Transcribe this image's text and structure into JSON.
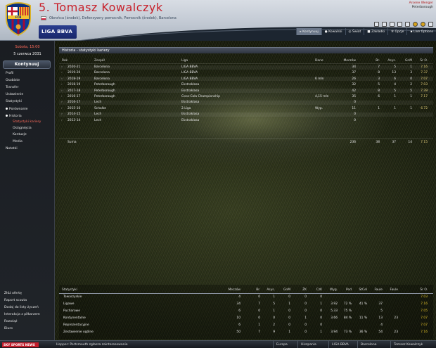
{
  "header": {
    "player_name": "5. Tomasz Kowalczyk",
    "positions": "Obrońca (środek), Defensywny pomocnik, Pomocnik (środek), Barcelona",
    "league_logo_text": "LIGA BBVA",
    "manager_name": "Arsene Wenger",
    "manager_club": "Peterborough",
    "flag_colors": [
      "#ffffff",
      "#d4213d"
    ]
  },
  "toolbar": {
    "items": [
      {
        "label": "Kontynuuj",
        "icon": "arrow-icon"
      },
      {
        "label": "Kowalski",
        "icon": "person-icon"
      },
      {
        "label": "Świat",
        "icon": "globe-icon"
      },
      {
        "label": "Zakładki",
        "icon": "bookmark-icon"
      },
      {
        "label": "Opcje",
        "icon": "gear-icon"
      },
      {
        "label": "Live Options",
        "icon": "live-icon"
      }
    ]
  },
  "sidebar": {
    "date": "Sobota, 15:00",
    "date2": "5 czerwca 2031",
    "continue_label": "Kontynuuj",
    "items": [
      {
        "label": "Profil",
        "sub": false,
        "active": false,
        "dot": false
      },
      {
        "label": "Osobiste",
        "sub": false,
        "active": false,
        "dot": false
      },
      {
        "label": "Transfer",
        "sub": false,
        "active": false,
        "dot": false
      },
      {
        "label": "Ustawienie",
        "sub": false,
        "active": false,
        "dot": false
      },
      {
        "label": "Statystyki",
        "sub": false,
        "active": false,
        "dot": false
      },
      {
        "label": "Porównanie",
        "sub": false,
        "active": false,
        "dot": true
      },
      {
        "label": "Historia",
        "sub": false,
        "active": false,
        "dot": true
      },
      {
        "label": "Statystyki kariery",
        "sub": true,
        "active": true,
        "dot": false
      },
      {
        "label": "Osiągnięcia",
        "sub": true,
        "active": false,
        "dot": false
      },
      {
        "label": "Kontuzje",
        "sub": true,
        "active": false,
        "dot": false
      },
      {
        "label": "Media",
        "sub": true,
        "active": false,
        "dot": false
      },
      {
        "label": "Notatki",
        "sub": false,
        "active": false,
        "dot": false
      }
    ],
    "bottom_items": [
      "Złóż ofertę",
      "Raport scouta",
      "Dodaj do listy życzeń",
      "Interakcja z piłkarzem",
      "Rozwiąż",
      "Biuro"
    ]
  },
  "career": {
    "title": "Historia - statystyki kariery",
    "columns": [
      "Rok",
      "Zespół",
      "Liga",
      "Dane",
      "Meczów",
      "Br.",
      "Asys.",
      "GnM",
      "Śr O."
    ],
    "rows": [
      [
        "2020-21",
        "Barcelona",
        "LIGA BBVA",
        "",
        "34",
        "7",
        "5",
        "1",
        "7.16"
      ],
      [
        "2019-20",
        "Barcelona",
        "LIGA BBVA",
        "",
        "37",
        "8",
        "13",
        "3",
        "7.37"
      ],
      [
        "2018-19",
        "Barcelona",
        "LIGA BBVA",
        "6 mln",
        "26",
        "3",
        "6",
        "0",
        "7.07"
      ],
      [
        "2018-19",
        "Peterborough",
        "Ekstraklasa",
        "",
        "32",
        "5",
        "4",
        "2",
        "7.03"
      ],
      [
        "2017-18",
        "Peterborough",
        "Ekstraklasa",
        "",
        "42",
        "8",
        "5",
        "5",
        "7.39"
      ],
      [
        "2016-17",
        "Peterborough",
        "Coca-Cola Championship",
        "4,15 mln",
        "35",
        "6",
        "1",
        "1",
        "7.17"
      ],
      [
        "2016-17",
        "Lech",
        "Ekstraklasa",
        "",
        "0",
        "",
        "",
        "",
        ""
      ],
      [
        "2015-16",
        "Schalke",
        "2.Liga",
        "Wyp.",
        "11",
        "1",
        "1",
        "1",
        "6.72"
      ],
      [
        "2014-15",
        "Lech",
        "Ekstraklasa",
        "",
        "0",
        "",
        "",
        "",
        ""
      ],
      [
        "2013-14",
        "Lech",
        "Ekstraklasa",
        "",
        "0",
        "",
        "",
        "",
        ""
      ]
    ],
    "total": [
      "Suma",
      "",
      "",
      "",
      "236",
      "38",
      "37",
      "14",
      "7.15"
    ]
  },
  "stats": {
    "columns": [
      "Statystyki",
      "Meczów",
      "Br.",
      "Asys.",
      "GnM",
      "ŻK",
      "CzK",
      "Wyg.",
      "Pod",
      "StCel",
      "Faule",
      "Faule",
      "Śr O."
    ],
    "rows": [
      [
        "Towarzyskie",
        "4",
        "0",
        "1",
        "0",
        "0",
        "0",
        "",
        "",
        "",
        "",
        "",
        "7.03"
      ],
      [
        "Ligowe",
        "34",
        "7",
        "5",
        "1",
        "0",
        "1",
        "3.92",
        "72 %",
        "41 %",
        "37",
        "",
        "7.16"
      ],
      [
        "Pucharowe",
        "6",
        "0",
        "1",
        "0",
        "0",
        "0",
        "5.33",
        "75 %",
        "",
        "5",
        "",
        "7.05"
      ],
      [
        "Kontynentalne",
        "10",
        "0",
        "0",
        "0",
        "1",
        "0",
        "3.66",
        "84 %",
        "11 %",
        "13",
        "23",
        "7.07"
      ],
      [
        "Reprezentacyjne",
        "6",
        "1",
        "2",
        "0",
        "0",
        "0",
        "",
        "",
        "",
        "4",
        "",
        "7.07"
      ],
      [
        "Zestawienie ogólne",
        "50",
        "7",
        "9",
        "1",
        "0",
        "1",
        "3.94",
        "73 %",
        "36 %",
        "54",
        "23",
        "7.16"
      ]
    ]
  },
  "footer": {
    "logo": "SKY SPORTS NEWS",
    "news": "Hopper: Portsmouth zgłasza zainteresowanie",
    "segments": [
      "Europa",
      "Hiszpania",
      "LIGA BBVA",
      "Barcelona",
      "Tomasz Kowalczyk"
    ]
  },
  "colors": {
    "accent_red": "#c8202a",
    "highlight_gold": "#e6d17a",
    "rating_yellow": "#e2c22a"
  }
}
